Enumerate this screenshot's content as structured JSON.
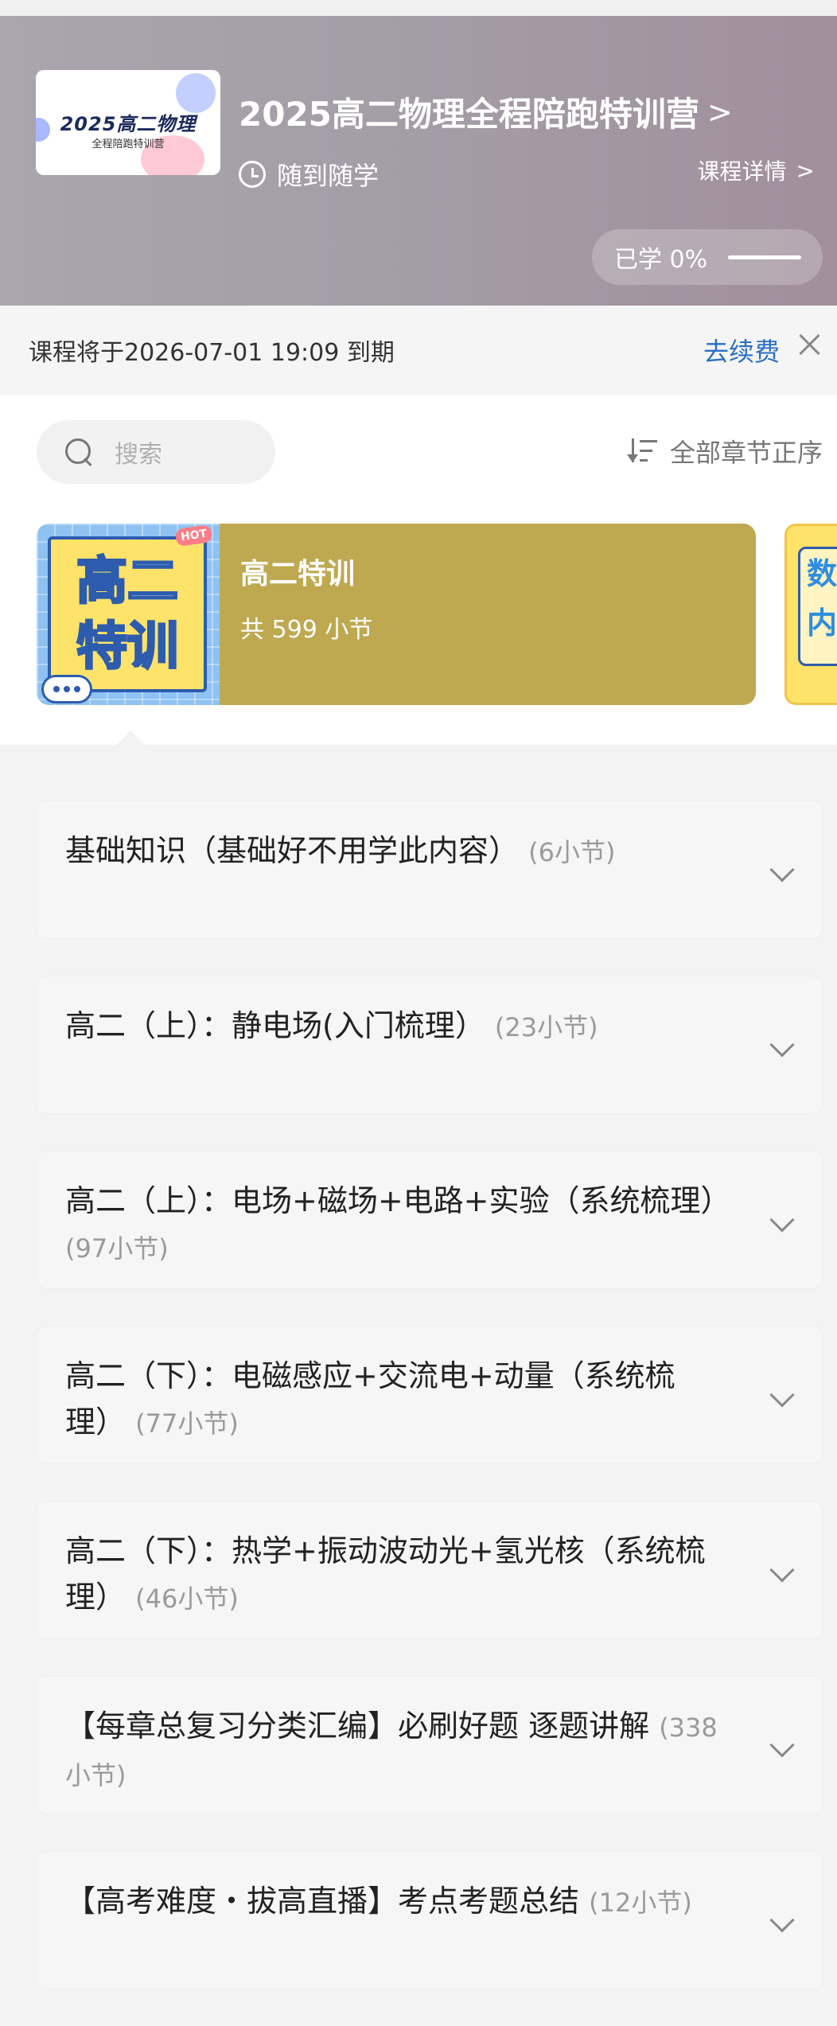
{
  "header": {
    "thumbnail_title": "2025高二物理",
    "thumbnail_subtitle": "全程陪跑特训营",
    "course_title": "2025高二物理全程陪跑特训营",
    "title_chevron": ">",
    "schedule": "随到随学",
    "details_link": "课程详情",
    "details_chevron": ">",
    "progress_label": "已学 0%",
    "progress_value": 0
  },
  "expiry": {
    "text": "课程将于2026-07-01 19:09 到期",
    "renew_label": "去续费"
  },
  "search": {
    "placeholder": "搜索"
  },
  "sort": {
    "label": "全部章节正序"
  },
  "featured_card": {
    "cover_line1": "高二",
    "cover_line2": "特训",
    "hot_badge": "HOT",
    "title": "高二特训",
    "count": "共 599 小节",
    "peek_text_1": "数",
    "peek_text_2": "内"
  },
  "chapters": [
    {
      "title": "基础知识（基础好不用学此内容）",
      "count": "(6小节)"
    },
    {
      "title": "高二（上）：静电场(入门梳理）",
      "count": "(23小节)"
    },
    {
      "title": "高二（上）：电场+磁场+电路+实验（系统梳理）",
      "count": "(97小节)"
    },
    {
      "title": "高二（下）：电磁感应+交流电+动量（系统梳理）",
      "count": "(77小节)"
    },
    {
      "title": "高二（下）：热学+振动波动光+氢光核（系统梳理）",
      "count": "(46小节)"
    },
    {
      "title": "【每章总复习分类汇编】必刷好题 逐题讲解",
      "count": "(338小节)"
    },
    {
      "title": "【高考难度・拔高直播】考点考题总结",
      "count": "(12小节)"
    }
  ]
}
